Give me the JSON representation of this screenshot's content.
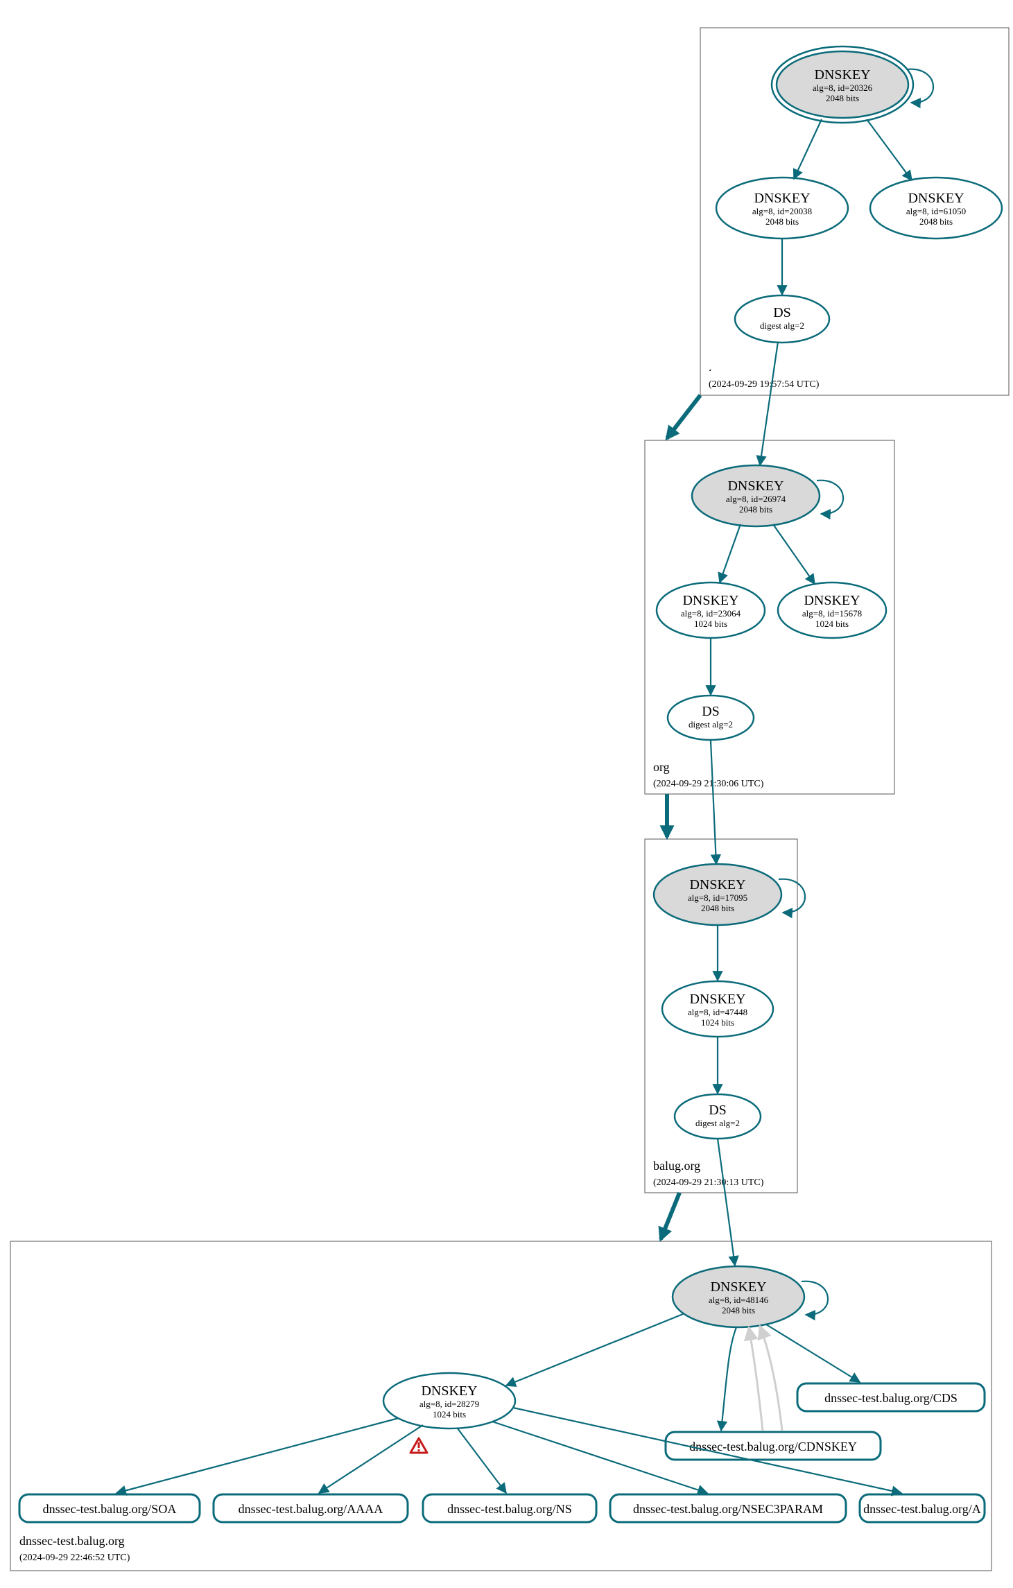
{
  "colors": {
    "teal": "#0b6b7a",
    "kskFill": "#d9d9d9",
    "lightGrey": "#cfcfcf",
    "warnRed": "#c71a1a"
  },
  "zones": {
    "root": {
      "name": ".",
      "timestamp": "(2024-09-29 19:57:54 UTC)",
      "ksk": {
        "title": "DNSKEY",
        "alg": "alg=8, id=20326",
        "bits": "2048 bits"
      },
      "zsk1": {
        "title": "DNSKEY",
        "alg": "alg=8, id=20038",
        "bits": "2048 bits"
      },
      "zsk2": {
        "title": "DNSKEY",
        "alg": "alg=8, id=61050",
        "bits": "2048 bits"
      },
      "ds": {
        "title": "DS",
        "alg": "digest alg=2"
      }
    },
    "org": {
      "name": "org",
      "timestamp": "(2024-09-29 21:30:06 UTC)",
      "ksk": {
        "title": "DNSKEY",
        "alg": "alg=8, id=26974",
        "bits": "2048 bits"
      },
      "zsk1": {
        "title": "DNSKEY",
        "alg": "alg=8, id=23064",
        "bits": "1024 bits"
      },
      "zsk2": {
        "title": "DNSKEY",
        "alg": "alg=8, id=15678",
        "bits": "1024 bits"
      },
      "ds": {
        "title": "DS",
        "alg": "digest alg=2"
      }
    },
    "balug": {
      "name": "balug.org",
      "timestamp": "(2024-09-29 21:30:13 UTC)",
      "ksk": {
        "title": "DNSKEY",
        "alg": "alg=8, id=17095",
        "bits": "2048 bits"
      },
      "zsk": {
        "title": "DNSKEY",
        "alg": "alg=8, id=47448",
        "bits": "1024 bits"
      },
      "ds": {
        "title": "DS",
        "alg": "digest alg=2"
      }
    },
    "dnssec": {
      "name": "dnssec-test.balug.org",
      "timestamp": "(2024-09-29 22:46:52 UTC)",
      "ksk": {
        "title": "DNSKEY",
        "alg": "alg=8, id=48146",
        "bits": "2048 bits"
      },
      "zsk": {
        "title": "DNSKEY",
        "alg": "alg=8, id=28279",
        "bits": "1024 bits"
      },
      "rr": {
        "soa": "dnssec-test.balug.org/SOA",
        "aaaa": "dnssec-test.balug.org/AAAA",
        "ns": "dnssec-test.balug.org/NS",
        "nsec3": "dnssec-test.balug.org/NSEC3PARAM",
        "a": "dnssec-test.balug.org/A",
        "cdnskey": "dnssec-test.balug.org/CDNSKEY",
        "cds": "dnssec-test.balug.org/CDS"
      }
    }
  }
}
